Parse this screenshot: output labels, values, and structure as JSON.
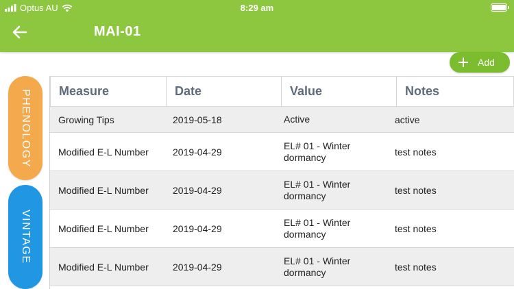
{
  "status_bar": {
    "carrier": "Optus AU",
    "time": "8:29 am"
  },
  "header": {
    "title": "MAI-01",
    "back_icon": "arrow-left-icon",
    "color": "#8dc63f"
  },
  "add_button": {
    "label": "Add",
    "icon": "plus-icon"
  },
  "side_tabs": [
    {
      "label": "PHENOLOGY",
      "color": "#f4a94d"
    },
    {
      "label": "VINTAGE",
      "color": "#2196e3"
    }
  ],
  "table": {
    "columns": [
      "Measure",
      "Date",
      "Value",
      "Notes"
    ],
    "rows": [
      {
        "measure": "Growing Tips",
        "date": "2019-05-18",
        "value": "Active",
        "notes": "active"
      },
      {
        "measure": "Modified E-L Number",
        "date": "2019-04-29",
        "value": "EL# 01 -  Winter dormancy",
        "notes": "test notes"
      },
      {
        "measure": "Modified E-L Number",
        "date": "2019-04-29",
        "value": "EL# 01 -  Winter dormancy",
        "notes": "test notes"
      },
      {
        "measure": "Modified E-L Number",
        "date": "2019-04-29",
        "value": "EL# 01 -  Winter dormancy",
        "notes": "test notes"
      },
      {
        "measure": "Modified E-L Number",
        "date": "2019-04-29",
        "value": "EL# 01 -  Winter dormancy",
        "notes": "test notes"
      }
    ]
  }
}
